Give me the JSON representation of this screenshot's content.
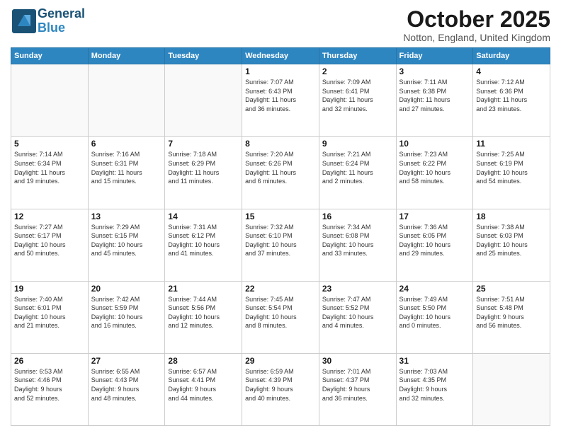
{
  "header": {
    "logo_line1": "General",
    "logo_line2": "Blue",
    "month": "October 2025",
    "location": "Notton, England, United Kingdom"
  },
  "days_of_week": [
    "Sunday",
    "Monday",
    "Tuesday",
    "Wednesday",
    "Thursday",
    "Friday",
    "Saturday"
  ],
  "weeks": [
    [
      {
        "day": "",
        "detail": ""
      },
      {
        "day": "",
        "detail": ""
      },
      {
        "day": "",
        "detail": ""
      },
      {
        "day": "1",
        "detail": "Sunrise: 7:07 AM\nSunset: 6:43 PM\nDaylight: 11 hours\nand 36 minutes."
      },
      {
        "day": "2",
        "detail": "Sunrise: 7:09 AM\nSunset: 6:41 PM\nDaylight: 11 hours\nand 32 minutes."
      },
      {
        "day": "3",
        "detail": "Sunrise: 7:11 AM\nSunset: 6:38 PM\nDaylight: 11 hours\nand 27 minutes."
      },
      {
        "day": "4",
        "detail": "Sunrise: 7:12 AM\nSunset: 6:36 PM\nDaylight: 11 hours\nand 23 minutes."
      }
    ],
    [
      {
        "day": "5",
        "detail": "Sunrise: 7:14 AM\nSunset: 6:34 PM\nDaylight: 11 hours\nand 19 minutes."
      },
      {
        "day": "6",
        "detail": "Sunrise: 7:16 AM\nSunset: 6:31 PM\nDaylight: 11 hours\nand 15 minutes."
      },
      {
        "day": "7",
        "detail": "Sunrise: 7:18 AM\nSunset: 6:29 PM\nDaylight: 11 hours\nand 11 minutes."
      },
      {
        "day": "8",
        "detail": "Sunrise: 7:20 AM\nSunset: 6:26 PM\nDaylight: 11 hours\nand 6 minutes."
      },
      {
        "day": "9",
        "detail": "Sunrise: 7:21 AM\nSunset: 6:24 PM\nDaylight: 11 hours\nand 2 minutes."
      },
      {
        "day": "10",
        "detail": "Sunrise: 7:23 AM\nSunset: 6:22 PM\nDaylight: 10 hours\nand 58 minutes."
      },
      {
        "day": "11",
        "detail": "Sunrise: 7:25 AM\nSunset: 6:19 PM\nDaylight: 10 hours\nand 54 minutes."
      }
    ],
    [
      {
        "day": "12",
        "detail": "Sunrise: 7:27 AM\nSunset: 6:17 PM\nDaylight: 10 hours\nand 50 minutes."
      },
      {
        "day": "13",
        "detail": "Sunrise: 7:29 AM\nSunset: 6:15 PM\nDaylight: 10 hours\nand 45 minutes."
      },
      {
        "day": "14",
        "detail": "Sunrise: 7:31 AM\nSunset: 6:12 PM\nDaylight: 10 hours\nand 41 minutes."
      },
      {
        "day": "15",
        "detail": "Sunrise: 7:32 AM\nSunset: 6:10 PM\nDaylight: 10 hours\nand 37 minutes."
      },
      {
        "day": "16",
        "detail": "Sunrise: 7:34 AM\nSunset: 6:08 PM\nDaylight: 10 hours\nand 33 minutes."
      },
      {
        "day": "17",
        "detail": "Sunrise: 7:36 AM\nSunset: 6:05 PM\nDaylight: 10 hours\nand 29 minutes."
      },
      {
        "day": "18",
        "detail": "Sunrise: 7:38 AM\nSunset: 6:03 PM\nDaylight: 10 hours\nand 25 minutes."
      }
    ],
    [
      {
        "day": "19",
        "detail": "Sunrise: 7:40 AM\nSunset: 6:01 PM\nDaylight: 10 hours\nand 21 minutes."
      },
      {
        "day": "20",
        "detail": "Sunrise: 7:42 AM\nSunset: 5:59 PM\nDaylight: 10 hours\nand 16 minutes."
      },
      {
        "day": "21",
        "detail": "Sunrise: 7:44 AM\nSunset: 5:56 PM\nDaylight: 10 hours\nand 12 minutes."
      },
      {
        "day": "22",
        "detail": "Sunrise: 7:45 AM\nSunset: 5:54 PM\nDaylight: 10 hours\nand 8 minutes."
      },
      {
        "day": "23",
        "detail": "Sunrise: 7:47 AM\nSunset: 5:52 PM\nDaylight: 10 hours\nand 4 minutes."
      },
      {
        "day": "24",
        "detail": "Sunrise: 7:49 AM\nSunset: 5:50 PM\nDaylight: 10 hours\nand 0 minutes."
      },
      {
        "day": "25",
        "detail": "Sunrise: 7:51 AM\nSunset: 5:48 PM\nDaylight: 9 hours\nand 56 minutes."
      }
    ],
    [
      {
        "day": "26",
        "detail": "Sunrise: 6:53 AM\nSunset: 4:46 PM\nDaylight: 9 hours\nand 52 minutes."
      },
      {
        "day": "27",
        "detail": "Sunrise: 6:55 AM\nSunset: 4:43 PM\nDaylight: 9 hours\nand 48 minutes."
      },
      {
        "day": "28",
        "detail": "Sunrise: 6:57 AM\nSunset: 4:41 PM\nDaylight: 9 hours\nand 44 minutes."
      },
      {
        "day": "29",
        "detail": "Sunrise: 6:59 AM\nSunset: 4:39 PM\nDaylight: 9 hours\nand 40 minutes."
      },
      {
        "day": "30",
        "detail": "Sunrise: 7:01 AM\nSunset: 4:37 PM\nDaylight: 9 hours\nand 36 minutes."
      },
      {
        "day": "31",
        "detail": "Sunrise: 7:03 AM\nSunset: 4:35 PM\nDaylight: 9 hours\nand 32 minutes."
      },
      {
        "day": "",
        "detail": ""
      }
    ]
  ]
}
